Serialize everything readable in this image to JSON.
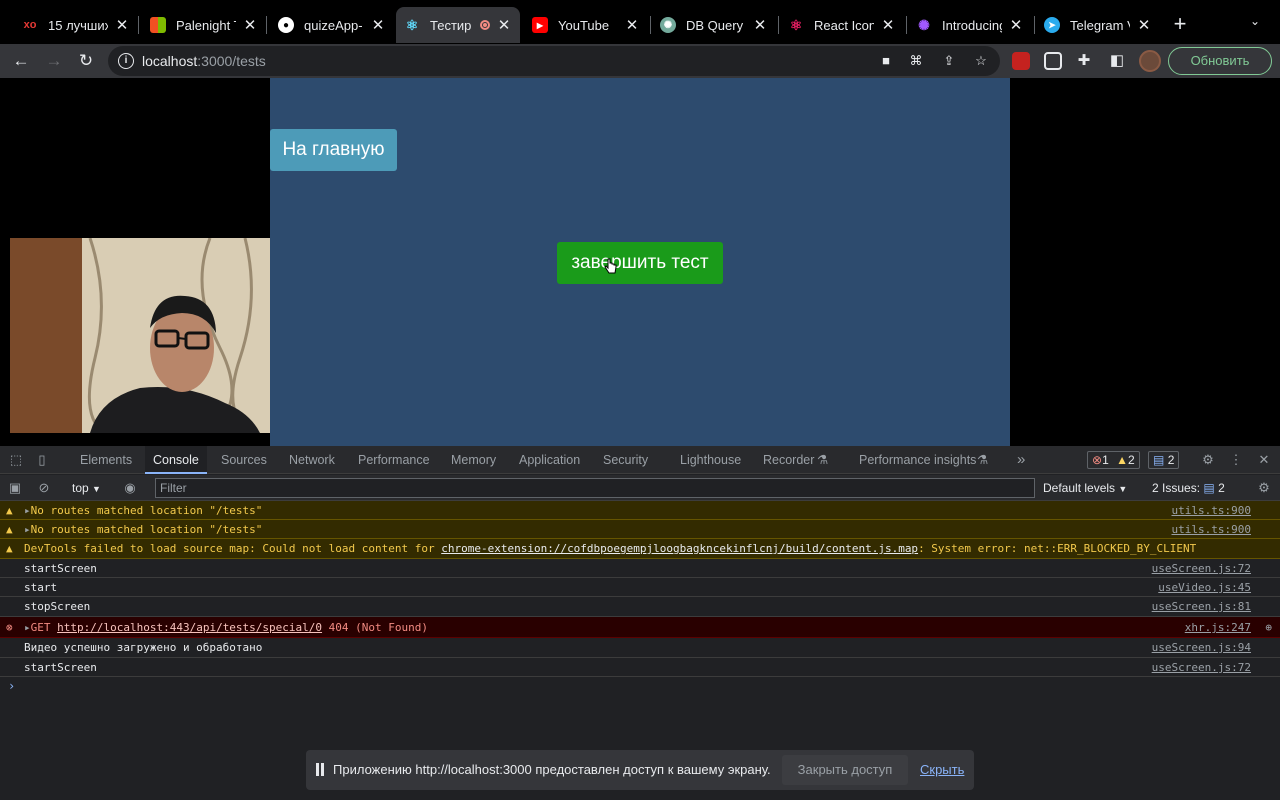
{
  "browser": {
    "tabs": [
      {
        "title": "15 лучших",
        "favicon": "xo-icon",
        "color": "#e53935"
      },
      {
        "title": "Palenight T",
        "favicon": "microsoft-icon",
        "color": "#f25022"
      },
      {
        "title": "quizeApp-",
        "favicon": "github-icon",
        "color": "#ffffff"
      },
      {
        "title": "Тестир",
        "favicon": "react-icon",
        "color": "#61dafb",
        "active": true
      },
      {
        "title": "YouTube",
        "favicon": "youtube-icon",
        "color": "#ff0000"
      },
      {
        "title": "DB Query v",
        "favicon": "chatgpt-icon",
        "color": "#74aa9c"
      },
      {
        "title": "React Icon",
        "favicon": "react-icons-icon",
        "color": "#e91e63"
      },
      {
        "title": "Introducing",
        "favicon": "openai-icon",
        "color": "#a259ff"
      },
      {
        "title": "Telegram V",
        "favicon": "telegram-icon",
        "color": "#2aabee"
      }
    ],
    "url_host": "localhost",
    "url_path": ":3000/tests",
    "update_label": "Обновить"
  },
  "page": {
    "home_button": "На главную",
    "finish_button": "завершить тест"
  },
  "devtools": {
    "tabs": [
      "Elements",
      "Console",
      "Sources",
      "Network",
      "Performance",
      "Memory",
      "Application",
      "Security",
      "Lighthouse",
      "Recorder",
      "Performance insights"
    ],
    "active_tab": "Console",
    "errors_count": "1",
    "warnings_count": "2",
    "messages_count": "2",
    "context": "top",
    "filter_placeholder": "Filter",
    "levels": "Default levels",
    "issues_label": "2 Issues:",
    "issues_count": "2",
    "console": [
      {
        "level": "warn",
        "text": "No routes matched location \"/tests\"",
        "source": "utils.ts:900"
      },
      {
        "level": "warn",
        "text": "No routes matched location \"/tests\"",
        "source": "utils.ts:900"
      },
      {
        "level": "warn",
        "text_before": "DevTools failed to load source map: Could not load content for ",
        "link": "chrome-extension://cofdbpoegempjloogbagkncekinflcnj/build/content.js.map",
        "text_after": ": System error: net::ERR_BLOCKED_BY_CLIENT"
      },
      {
        "level": "log",
        "text": "startScreen",
        "source": "useScreen.js:72"
      },
      {
        "level": "log",
        "text": "start",
        "source": "useVideo.js:45"
      },
      {
        "level": "log",
        "text": "stopScreen",
        "source": "useScreen.js:81"
      },
      {
        "level": "error",
        "method": "GET",
        "link": "http://localhost:443/api/tests/special/0",
        "status": "404 (Not Found)",
        "source": "xhr.js:247"
      },
      {
        "level": "log",
        "text": "Видео успешно загружено и обработано",
        "source": "useScreen.js:94"
      },
      {
        "level": "log",
        "text": "startScreen",
        "source": "useScreen.js:72"
      }
    ]
  },
  "share_bar": {
    "text": "Приложению http://localhost:3000 предоставлен доступ к вашему экрану.",
    "stop_label": "Закрыть доступ",
    "hide_label": "Скрыть"
  }
}
